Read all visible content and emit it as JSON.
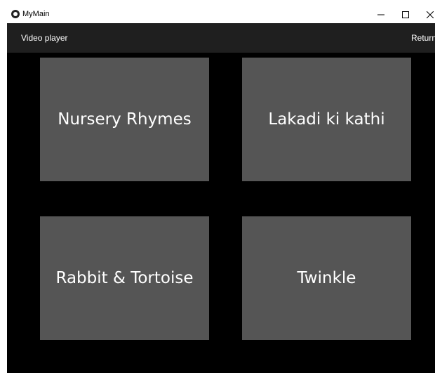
{
  "window": {
    "title": "MyMain",
    "icon": "app-logo-icon"
  },
  "toolbar": {
    "title": "Video player",
    "return_label": "Return"
  },
  "tiles": [
    {
      "label": "Nursery Rhymes"
    },
    {
      "label": "Lakadi ki kathi"
    },
    {
      "label": "Rabbit & Tortoise"
    },
    {
      "label": "Twinkle"
    }
  ],
  "colors": {
    "background": "#000000",
    "toolbar": "#1f1f1f",
    "tile": "#555555",
    "text": "#ffffff"
  }
}
